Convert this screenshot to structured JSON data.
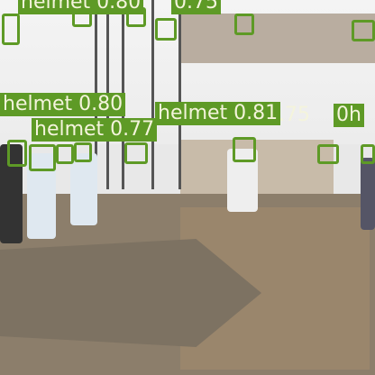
{
  "detections": {
    "class_name": "helmet",
    "box_color": "#5e9a26",
    "text_color": "#f4f4dc",
    "labels": [
      {
        "text": "helmet 0.80"
      },
      {
        "text": "helmet 0.81"
      },
      {
        "text": "helmet 0.77"
      },
      {
        "text": "0.75"
      },
      {
        "text": "0h"
      },
      {
        "text": "helmet 0.80"
      }
    ]
  }
}
